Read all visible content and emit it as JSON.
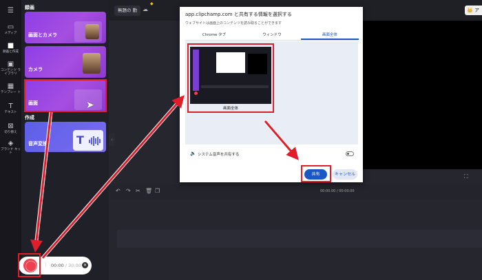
{
  "rail": {
    "items": [
      {
        "icon": "folder-icon",
        "glyph": "▭",
        "label": "メディア"
      },
      {
        "icon": "camera-icon",
        "glyph": "■",
        "label": "録画と作成"
      },
      {
        "icon": "library-icon",
        "glyph": "▣",
        "label": "コンテンツ ライブラリ"
      },
      {
        "icon": "template-icon",
        "glyph": "▦",
        "label": "テンプレー ト"
      },
      {
        "icon": "text-icon",
        "glyph": "T",
        "label": "テキスト"
      },
      {
        "icon": "transition-icon",
        "glyph": "⊠",
        "label": "切り替え"
      },
      {
        "icon": "brand-kit-icon",
        "glyph": "◈",
        "label": "ブランド キット"
      }
    ]
  },
  "panel": {
    "section_record": "録画",
    "cards": [
      "画面とカメラ",
      "カメラ",
      "画面"
    ],
    "section_create": "作成",
    "voice_card": "音声変換",
    "voice_glyph": "T"
  },
  "topbar": {
    "project_title": "無題の 動",
    "upgrade_glyph": "👑 ア"
  },
  "timeline": {
    "timecode": "00:00.00 / 00:00.00"
  },
  "recorder": {
    "current": "00:00",
    "total": "/ 30:00",
    "close_glyph": "✕"
  },
  "dialog": {
    "title": "app.clipchamp.com と共有する情報を選択する",
    "subtitle": "ウェブサイトは画面上のコンテンツを読み取ることができます",
    "tabs": [
      "Chrome タブ",
      "ウィンドウ",
      "画面全体"
    ],
    "selected_tab": 2,
    "thumb_label": "画面全体",
    "audio_label": "システム音声を共有する",
    "share_button": "共有",
    "cancel_button": "キャンセル"
  },
  "colors": {
    "highlight": "#e01e2b",
    "accent_blue": "#1a56c4",
    "card_purple": "#9b45e4"
  }
}
